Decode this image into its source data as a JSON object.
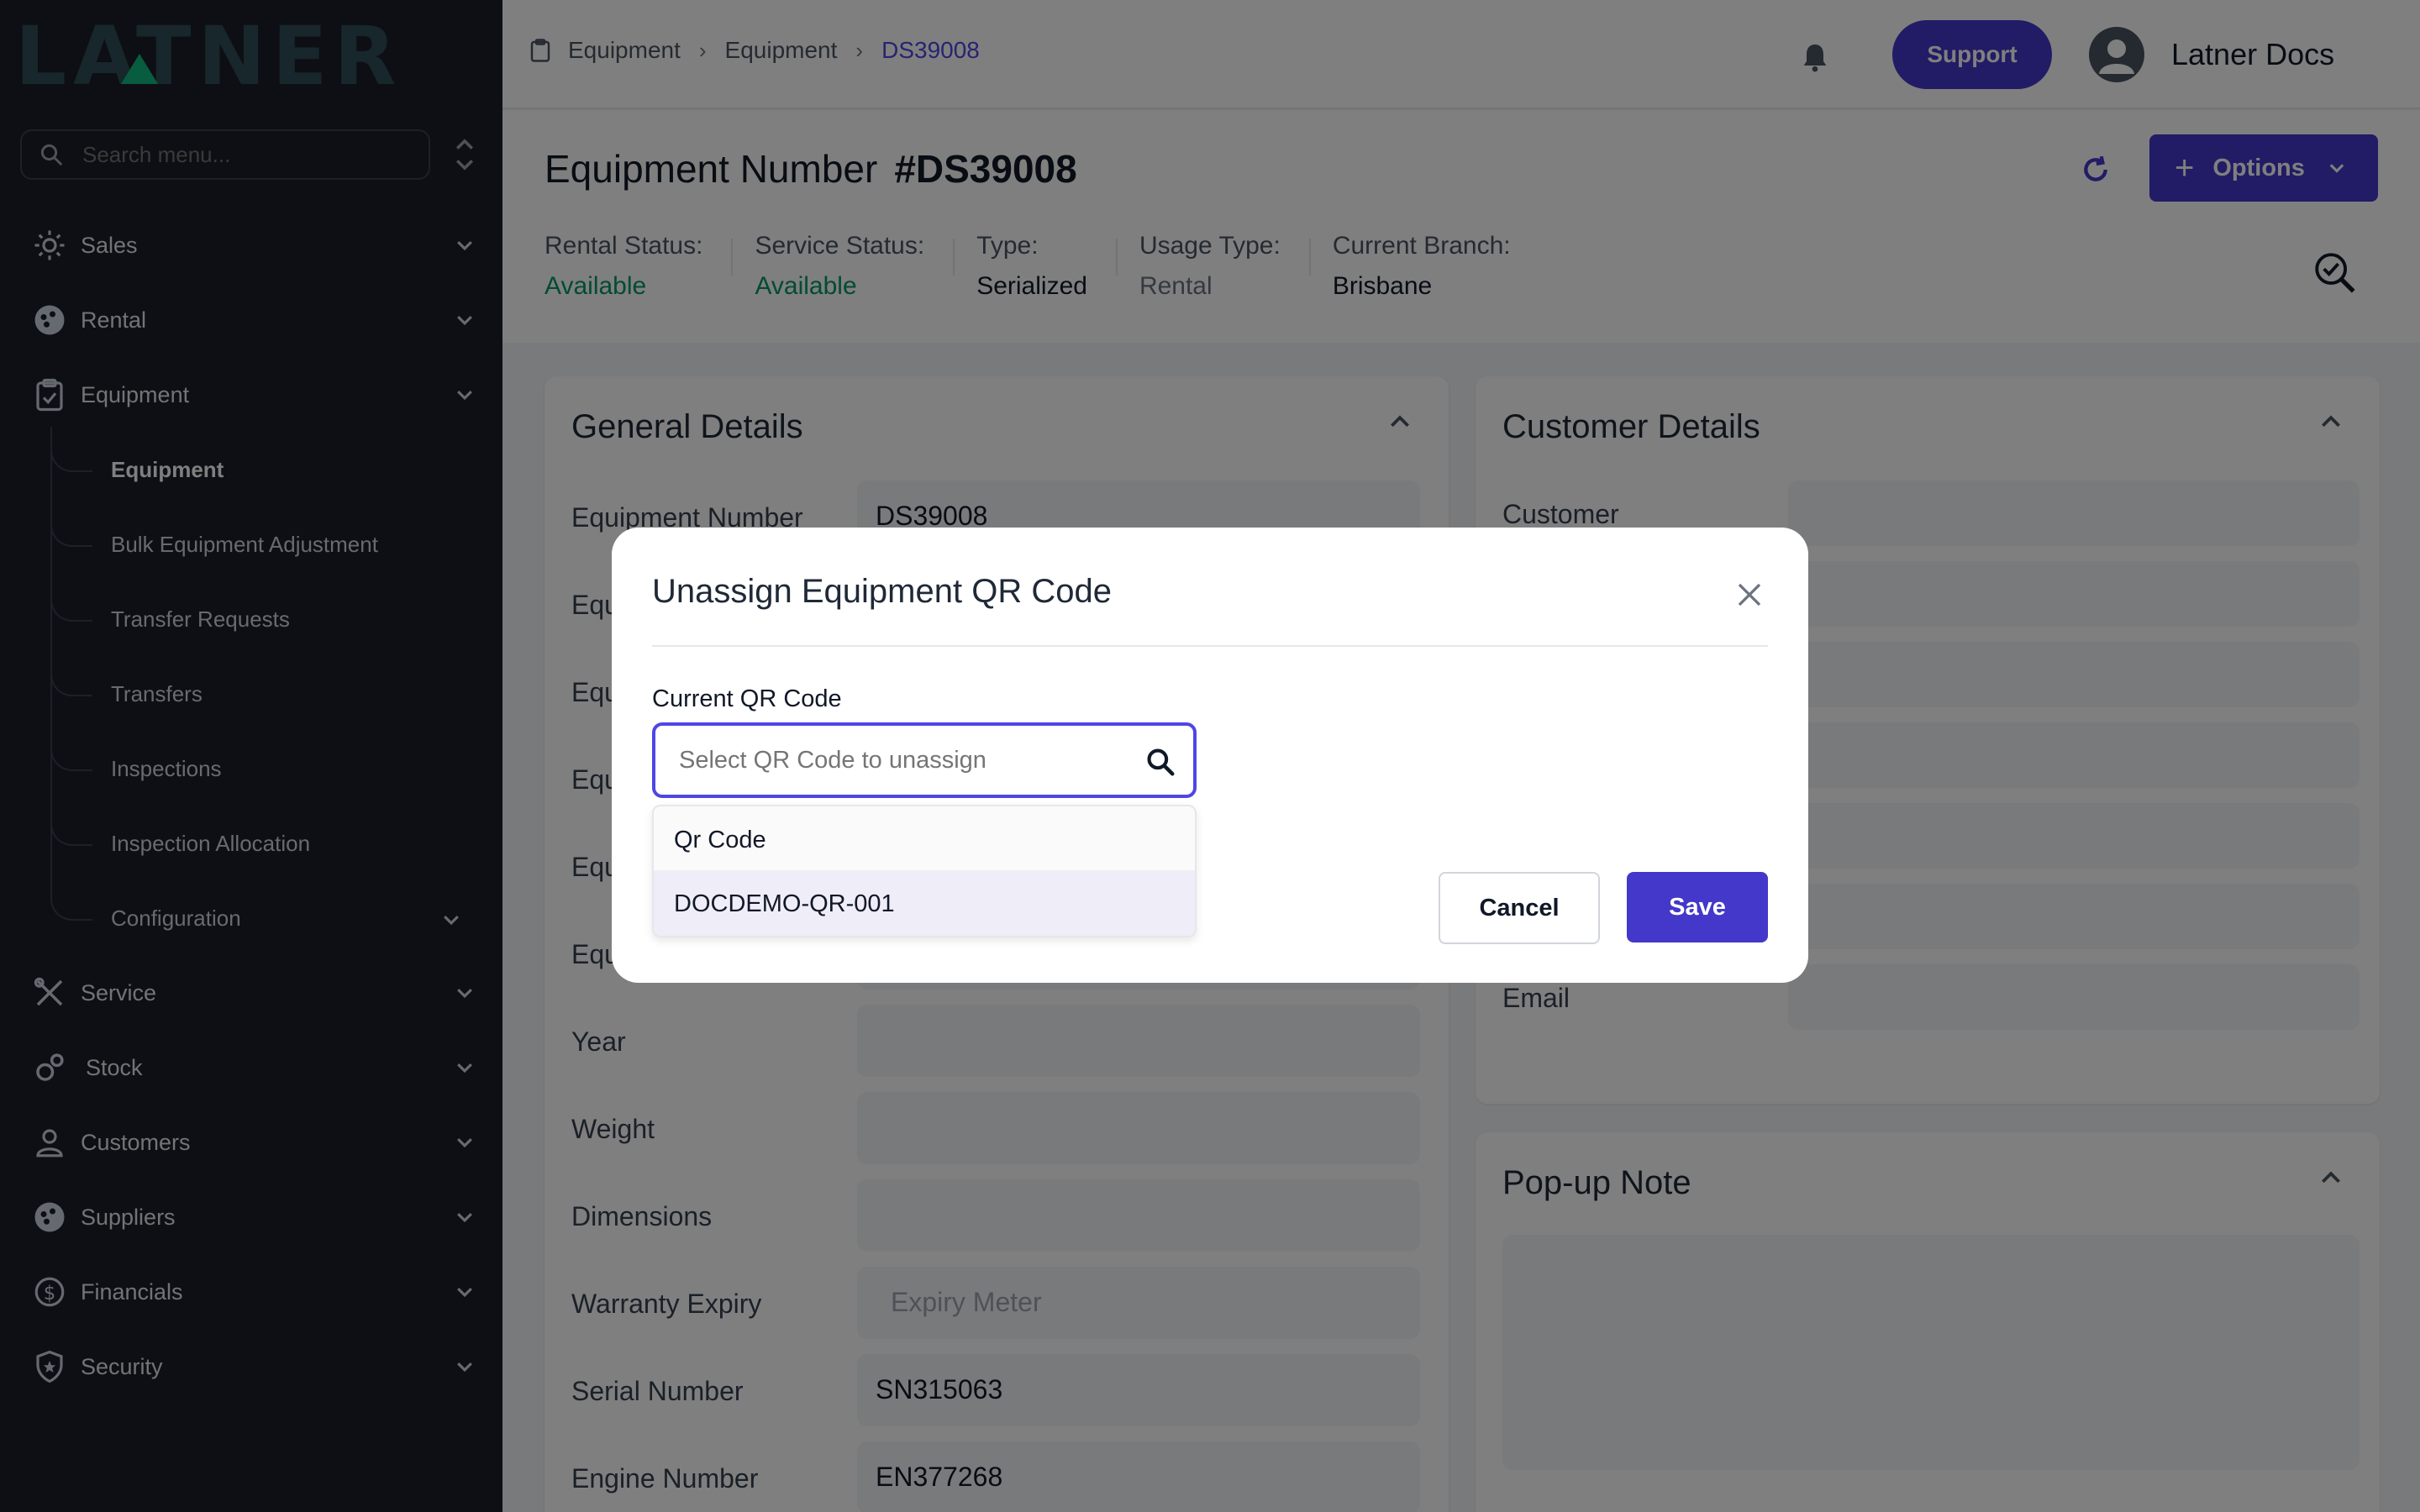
{
  "brand": {
    "logo_text": "LATNER"
  },
  "sidebar": {
    "search_placeholder": "Search menu...",
    "items": [
      {
        "label": "Sales"
      },
      {
        "label": "Rental"
      },
      {
        "label": "Equipment"
      },
      {
        "label": "Service"
      },
      {
        "label": "Stock"
      },
      {
        "label": "Customers"
      },
      {
        "label": "Suppliers"
      },
      {
        "label": "Financials"
      },
      {
        "label": "Security"
      }
    ],
    "equipment_sub": [
      {
        "label": "Equipment"
      },
      {
        "label": "Bulk Equipment Adjustment"
      },
      {
        "label": "Transfer Requests"
      },
      {
        "label": "Transfers"
      },
      {
        "label": "Inspections"
      },
      {
        "label": "Inspection Allocation"
      },
      {
        "label": "Configuration"
      }
    ]
  },
  "topbar": {
    "breadcrumbs": [
      "Equipment",
      "Equipment",
      "DS39008"
    ],
    "support_label": "Support",
    "user_name": "Latner Docs"
  },
  "header": {
    "title_prefix": "Equipment Number",
    "title_number": "#DS39008",
    "options_label": "Options",
    "stats": [
      {
        "label": "Rental Status:",
        "value": "Available"
      },
      {
        "label": "Service Status:",
        "value": "Available"
      },
      {
        "label": "Type:",
        "value": "Serialized"
      },
      {
        "label": "Usage Type:",
        "value": "Rental"
      },
      {
        "label": "Current Branch:",
        "value": "Brisbane"
      }
    ]
  },
  "general_details": {
    "title": "General Details",
    "fields": [
      {
        "label": "Equipment Number",
        "value": "DS39008"
      },
      {
        "label": "Equ",
        "value": ""
      },
      {
        "label": "Equ",
        "value": ""
      },
      {
        "label": "Equ",
        "value": ""
      },
      {
        "label": "Equ",
        "value": ""
      },
      {
        "label": "Equ",
        "value": ""
      },
      {
        "label": "Year",
        "value": ""
      },
      {
        "label": "Weight",
        "value": ""
      },
      {
        "label": "Dimensions",
        "value": ""
      },
      {
        "label": "Warranty Expiry",
        "value": "Expiry Meter"
      },
      {
        "label": "Serial Number",
        "value": "SN315063"
      },
      {
        "label": "Engine Number",
        "value": "EN377268"
      }
    ]
  },
  "customer_details": {
    "title": "Customer Details",
    "customer_label": "Customer",
    "email_label": "Email"
  },
  "popup_note": {
    "title": "Pop-up Note"
  },
  "modal": {
    "title": "Unassign Equipment QR Code",
    "field_label": "Current QR Code",
    "placeholder": "Select QR Code to unassign",
    "dropdown_header": "Qr Code",
    "dropdown_option": "DOCDEMO-QR-001",
    "cancel_label": "Cancel",
    "save_label": "Save"
  }
}
